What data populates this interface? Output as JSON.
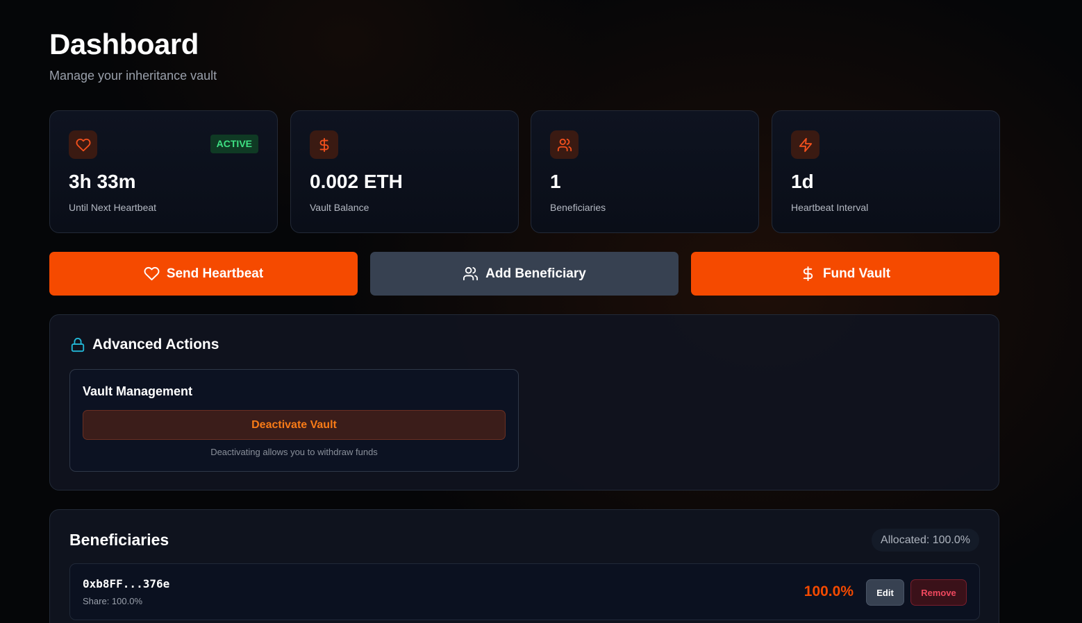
{
  "header": {
    "title": "Dashboard",
    "subtitle": "Manage your inheritance vault"
  },
  "stats": [
    {
      "icon": "heart-icon",
      "value": "3h 33m",
      "label": "Until Next Heartbeat",
      "badge": "ACTIVE"
    },
    {
      "icon": "dollar-icon",
      "value": "0.002 ETH",
      "label": "Vault Balance"
    },
    {
      "icon": "users-icon",
      "value": "1",
      "label": "Beneficiaries"
    },
    {
      "icon": "lightning-icon",
      "value": "1d",
      "label": "Heartbeat Interval"
    }
  ],
  "actions": {
    "send_heartbeat": "Send Heartbeat",
    "add_beneficiary": "Add Beneficiary",
    "fund_vault": "Fund Vault"
  },
  "advanced": {
    "title": "Advanced Actions",
    "vault_management": {
      "title": "Vault Management",
      "deactivate_label": "Deactivate Vault",
      "note": "Deactivating allows you to withdraw funds"
    }
  },
  "beneficiaries": {
    "title": "Beneficiaries",
    "allocated": "Allocated: 100.0%",
    "items": [
      {
        "address": "0xb8FF...376e",
        "share": "Share: 100.0%",
        "percent": "100.0%",
        "edit_label": "Edit",
        "remove_label": "Remove"
      }
    ]
  },
  "colors": {
    "accent_orange": "#f54a00",
    "slate_button": "#374151",
    "active_badge_text": "#3ee083",
    "lock_icon": "#22b8d8",
    "danger": "#f0485e"
  }
}
